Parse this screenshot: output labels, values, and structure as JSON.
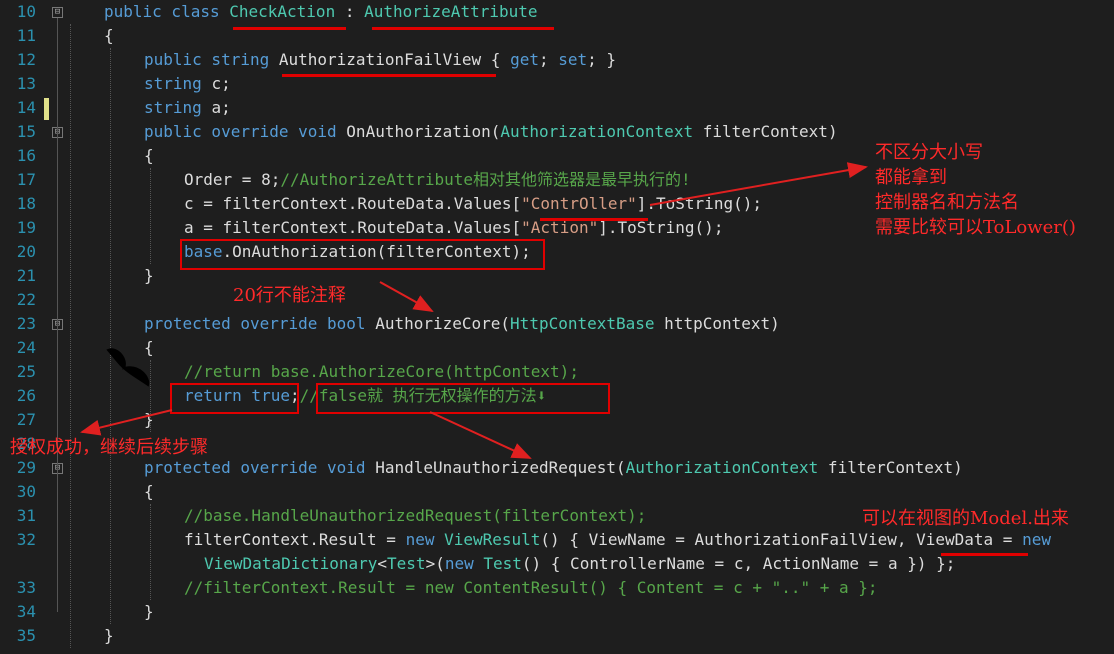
{
  "editor": {
    "lines": [
      {
        "n": "10",
        "indent": 40,
        "tokens": [
          {
            "t": "public class ",
            "c": "kw"
          },
          {
            "t": "CheckAction",
            "c": "ty"
          },
          {
            "t": " : ",
            "c": "pl"
          },
          {
            "t": "AuthorizeAttribute",
            "c": "ty"
          }
        ]
      },
      {
        "n": "11",
        "indent": 40,
        "tokens": [
          {
            "t": "{",
            "c": "pl"
          }
        ]
      },
      {
        "n": "12",
        "indent": 80,
        "tokens": [
          {
            "t": "public string ",
            "c": "kw"
          },
          {
            "t": "AuthorizationFailView",
            "c": "pl"
          },
          {
            "t": " { ",
            "c": "pl"
          },
          {
            "t": "get",
            "c": "kw"
          },
          {
            "t": "; ",
            "c": "pl"
          },
          {
            "t": "set",
            "c": "kw"
          },
          {
            "t": "; }",
            "c": "pl"
          }
        ]
      },
      {
        "n": "13",
        "indent": 80,
        "tokens": [
          {
            "t": "string ",
            "c": "kw"
          },
          {
            "t": "c;",
            "c": "pl"
          }
        ]
      },
      {
        "n": "14",
        "indent": 80,
        "tokens": [
          {
            "t": "string ",
            "c": "kw"
          },
          {
            "t": "a;",
            "c": "pl"
          }
        ]
      },
      {
        "n": "15",
        "indent": 80,
        "tokens": [
          {
            "t": "public override void ",
            "c": "kw"
          },
          {
            "t": "OnAuthorization(",
            "c": "pl"
          },
          {
            "t": "AuthorizationContext",
            "c": "ty"
          },
          {
            "t": " filterContext)",
            "c": "pl"
          }
        ]
      },
      {
        "n": "16",
        "indent": 80,
        "tokens": [
          {
            "t": "{",
            "c": "pl"
          }
        ]
      },
      {
        "n": "17",
        "indent": 120,
        "tokens": [
          {
            "t": "Order = 8;",
            "c": "pl"
          },
          {
            "t": "//AuthorizeAttribute相对其他筛选器是最早执行的!",
            "c": "cm"
          }
        ]
      },
      {
        "n": "18",
        "indent": 120,
        "tokens": [
          {
            "t": "c = filterContext.RouteData.Values[",
            "c": "pl"
          },
          {
            "t": "\"ContrOller\"",
            "c": "st"
          },
          {
            "t": "].ToString();",
            "c": "pl"
          }
        ]
      },
      {
        "n": "19",
        "indent": 120,
        "tokens": [
          {
            "t": "a = filterContext.RouteData.Values[",
            "c": "pl"
          },
          {
            "t": "\"Action\"",
            "c": "st"
          },
          {
            "t": "].ToString();",
            "c": "pl"
          }
        ]
      },
      {
        "n": "20",
        "indent": 120,
        "tokens": [
          {
            "t": "base",
            "c": "kw"
          },
          {
            "t": ".OnAuthorization(filterContext);",
            "c": "pl"
          }
        ]
      },
      {
        "n": "21",
        "indent": 80,
        "tokens": [
          {
            "t": "}",
            "c": "pl"
          }
        ]
      },
      {
        "n": "22",
        "indent": 0,
        "tokens": []
      },
      {
        "n": "23",
        "indent": 80,
        "tokens": [
          {
            "t": "protected override bool ",
            "c": "kw"
          },
          {
            "t": "AuthorizeCore(",
            "c": "pl"
          },
          {
            "t": "HttpContextBase",
            "c": "ty"
          },
          {
            "t": " httpContext)",
            "c": "pl"
          }
        ]
      },
      {
        "n": "24",
        "indent": 80,
        "tokens": [
          {
            "t": "{",
            "c": "pl"
          }
        ]
      },
      {
        "n": "25",
        "indent": 120,
        "tokens": [
          {
            "t": "//return base.AuthorizeCore(httpContext);",
            "c": "cm"
          }
        ]
      },
      {
        "n": "26",
        "indent": 120,
        "tokens": [
          {
            "t": "return true",
            "c": "kw"
          },
          {
            "t": ";",
            "c": "pl"
          },
          {
            "t": "//false就 执行无权操作的方法⬇",
            "c": "cm"
          }
        ]
      },
      {
        "n": "27",
        "indent": 80,
        "tokens": [
          {
            "t": "}",
            "c": "pl"
          }
        ]
      },
      {
        "n": "28",
        "indent": 0,
        "tokens": []
      },
      {
        "n": "29",
        "indent": 80,
        "tokens": [
          {
            "t": "protected override void ",
            "c": "kw"
          },
          {
            "t": "HandleUnauthorizedRequest(",
            "c": "pl"
          },
          {
            "t": "AuthorizationContext",
            "c": "ty"
          },
          {
            "t": " filterContext)",
            "c": "pl"
          }
        ]
      },
      {
        "n": "30",
        "indent": 80,
        "tokens": [
          {
            "t": "{",
            "c": "pl"
          }
        ]
      },
      {
        "n": "31",
        "indent": 120,
        "tokens": [
          {
            "t": "//base.HandleUnauthorizedRequest(filterContext);",
            "c": "cm"
          }
        ]
      },
      {
        "n": "32",
        "indent": 120,
        "tokens": [
          {
            "t": "filterContext.Result = ",
            "c": "pl"
          },
          {
            "t": "new ",
            "c": "kw"
          },
          {
            "t": "ViewResult",
            "c": "ty"
          },
          {
            "t": "() { ViewName = AuthorizationFailView, ViewData = ",
            "c": "pl"
          },
          {
            "t": "new",
            "c": "kw"
          }
        ]
      },
      {
        "n": "",
        "indent": 140,
        "tokens": [
          {
            "t": "ViewDataDictionary",
            "c": "ty"
          },
          {
            "t": "<",
            "c": "pl"
          },
          {
            "t": "Test",
            "c": "ty"
          },
          {
            "t": ">(",
            "c": "pl"
          },
          {
            "t": "new ",
            "c": "kw"
          },
          {
            "t": "Test",
            "c": "ty"
          },
          {
            "t": "() { ControllerName = c, ActionName = a }) };",
            "c": "pl"
          }
        ]
      },
      {
        "n": "33",
        "indent": 120,
        "tokens": [
          {
            "t": "//filterContext.Result = new ContentResult() { Content = c + \"..\" + a };",
            "c": "cm"
          }
        ]
      },
      {
        "n": "34",
        "indent": 80,
        "tokens": [
          {
            "t": "}",
            "c": "pl"
          }
        ]
      },
      {
        "n": "35",
        "indent": 40,
        "tokens": [
          {
            "t": "}",
            "c": "pl"
          }
        ]
      }
    ],
    "fold_marker": "⊟"
  },
  "annotations": {
    "case_note": "不区分大小写\n都能拿到\n控制器名和方法名\n需要比较可以ToLower()",
    "line20_note": "20行不能注释",
    "auth_note": "授权成功，继续后续步骤",
    "model_note": "可以在视图的Model.出来"
  },
  "colors": {
    "keyword": "#569cd6",
    "type": "#4ec9b0",
    "string": "#d69d85",
    "comment": "#57a64a",
    "annotation": "#ff2a2a"
  }
}
